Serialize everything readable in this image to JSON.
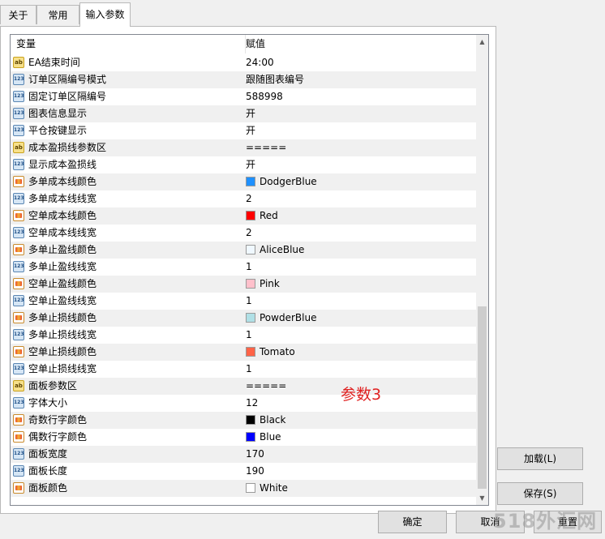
{
  "tabs": [
    {
      "label": "关于"
    },
    {
      "label": "常用"
    },
    {
      "label": "输入参数"
    }
  ],
  "table": {
    "col_variable": "变量",
    "col_value": "赋值"
  },
  "rows": [
    {
      "icon": "string-icon",
      "name": "EA结束时间",
      "value": "24:00"
    },
    {
      "icon": "number-icon",
      "name": "订单区隔编号模式",
      "value": "跟随图表编号"
    },
    {
      "icon": "number-icon",
      "name": "固定订单区隔编号",
      "value": "588998"
    },
    {
      "icon": "number-icon",
      "name": "图表信息显示",
      "value": "开"
    },
    {
      "icon": "number-icon",
      "name": "平仓按键显示",
      "value": "开"
    },
    {
      "icon": "string-icon",
      "name": "成本盈损线参数区",
      "value": "====="
    },
    {
      "icon": "number-icon",
      "name": "显示成本盈损线",
      "value": "开"
    },
    {
      "icon": "color-icon",
      "name": "多单成本线颜色",
      "value": "DodgerBlue",
      "swatch": "#1e90ff"
    },
    {
      "icon": "number-icon",
      "name": "多单成本线线宽",
      "value": "2"
    },
    {
      "icon": "color-icon",
      "name": "空单成本线颜色",
      "value": "Red",
      "swatch": "#ff0000"
    },
    {
      "icon": "number-icon",
      "name": "空单成本线线宽",
      "value": "2"
    },
    {
      "icon": "color-icon",
      "name": "多单止盈线颜色",
      "value": "AliceBlue",
      "swatch": "#f0f8ff"
    },
    {
      "icon": "number-icon",
      "name": "多单止盈线线宽",
      "value": "1"
    },
    {
      "icon": "color-icon",
      "name": "空单止盈线颜色",
      "value": "Pink",
      "swatch": "#ffc0cb"
    },
    {
      "icon": "number-icon",
      "name": "空单止盈线线宽",
      "value": "1"
    },
    {
      "icon": "color-icon",
      "name": "多单止损线颜色",
      "value": "PowderBlue",
      "swatch": "#b0e0e6"
    },
    {
      "icon": "number-icon",
      "name": "多单止损线线宽",
      "value": "1"
    },
    {
      "icon": "color-icon",
      "name": "空单止损线颜色",
      "value": "Tomato",
      "swatch": "#ff6347"
    },
    {
      "icon": "number-icon",
      "name": "空单止损线线宽",
      "value": "1"
    },
    {
      "icon": "string-icon",
      "name": "面板参数区",
      "value": "====="
    },
    {
      "icon": "number-icon",
      "name": "字体大小",
      "value": "12"
    },
    {
      "icon": "color-icon",
      "name": "奇数行字颜色",
      "value": "Black",
      "swatch": "#000000"
    },
    {
      "icon": "color-icon",
      "name": "偶数行字颜色",
      "value": "Blue",
      "swatch": "#0000ff"
    },
    {
      "icon": "number-icon",
      "name": "面板宽度",
      "value": "170"
    },
    {
      "icon": "number-icon",
      "name": "面板长度",
      "value": "190"
    },
    {
      "icon": "color-icon",
      "name": "面板颜色",
      "value": "White",
      "swatch": "#ffffff"
    }
  ],
  "buttons": {
    "load": "加载(L)",
    "save": "保存(S)",
    "ok": "确定",
    "cancel": "取消",
    "reset": "重置"
  },
  "annotation": "参数3",
  "watermark": "518外汇网",
  "icon_glyphs": {
    "string": "ab",
    "number": "123"
  }
}
